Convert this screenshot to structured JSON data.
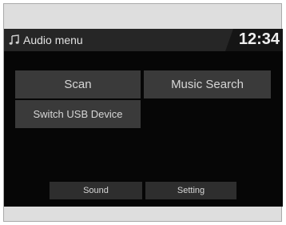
{
  "header": {
    "title": "Audio menu",
    "clock": "12:34",
    "icon": "music-note-icon"
  },
  "menu": {
    "scan_label": "Scan",
    "music_search_label": "Music Search",
    "switch_usb_label": "Switch USB Device"
  },
  "footer": {
    "sound_label": "Sound",
    "setting_label": "Setting"
  },
  "colors": {
    "screen_bg": "#060606",
    "header_bg": "#262626",
    "button_bg": "#3a3a3a",
    "text": "#d6d6d6"
  }
}
